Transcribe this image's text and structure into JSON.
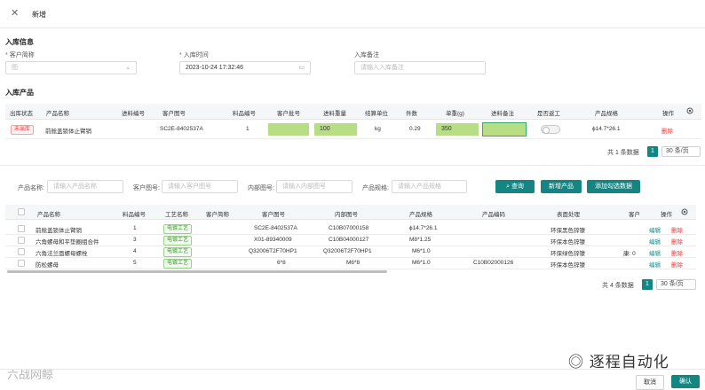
{
  "title": "新增",
  "section_info": "入库信息",
  "customer_label": "客户简称",
  "customer_value": "图 ",
  "intime_label": "入库时间",
  "intime_value": "2023-10-24 17:32:46",
  "remark_label": "入库备注",
  "remark_placeholder": "请输入入库备注",
  "section_products": "入库产品",
  "t1_headers": [
    "出库状态",
    "产品名称",
    "进料编号",
    "客户图号",
    "料品编号",
    "客户批号",
    "进料重量",
    "结算单位",
    "件数",
    "单重(g)",
    "进料备注",
    "是否返工",
    "产品规格",
    "操作"
  ],
  "t1_row": {
    "status": "未出库",
    "name": "前舱盖锁体止臂销",
    "code": "",
    "drawing": "SC2E-8402537A",
    "item_no": "1",
    "batch": "",
    "weight": "100",
    "unit": "kg",
    "count": "0.29",
    "unit_weight": "350",
    "note": "",
    "spec": "ϕ14.7*26.1",
    "op": "删除"
  },
  "pager1": {
    "total": "共 1 条数据",
    "page": "1",
    "size": "30 条/页"
  },
  "filter": {
    "name_label": "产品名称:",
    "name_ph": "请输入产品名称",
    "cust_label": "客户图号:",
    "cust_ph": "请输入客户图号",
    "inner_label": "内部图号:",
    "inner_ph": "请输入内部图号",
    "spec_label": "产品规格:",
    "spec_ph": "请输入产品规格"
  },
  "buttons": {
    "search": "查询",
    "new": "新增产品",
    "add_selected": "添加勾选数据",
    "cancel": "取消",
    "confirm": "确认"
  },
  "t2_headers": [
    "产品名称",
    "料品编号",
    "工艺名称",
    "客户简称",
    "客户图号",
    "内部图号",
    "产品规格",
    "产品编码",
    "表面处理",
    "客户",
    "操作"
  ],
  "t2_rows": [
    {
      "name": "前舱盖锁体止臂销",
      "no": "1",
      "proc": "电镀工艺",
      "cust": "",
      "cdraw": "SC2E-8402537A",
      "idraw": "C10B07000158",
      "spec": "ϕ14.7*26.1",
      "pcode": "",
      "surf": "环保黑色锌镍",
      "extra": ""
    },
    {
      "name": "六角螺母和平垫圈组合件",
      "no": "3",
      "proc": "电镀工艺",
      "cust": "",
      "cdraw": "X01-89340009",
      "idraw": "C10B04000127",
      "spec": "M8*1.25",
      "pcode": "",
      "surf": "环保本色锌镍",
      "extra": ""
    },
    {
      "name": "六角法兰面螺母螺栓",
      "no": "4",
      "proc": "电镀工艺",
      "cust": "",
      "cdraw": "Q32006T2F70HP1",
      "idraw": "Q32006T2F70HP1",
      "spec": "M6*1.0",
      "pcode": "",
      "surf": "环保绿色锌镍",
      "extra": "康: 0"
    },
    {
      "name": "防松螺母",
      "no": "5",
      "proc": "电镀工艺",
      "cust": "",
      "cdraw": "6*8",
      "idraw": "M6*8",
      "spec": "M6*1.0",
      "pcode": "C10B02000126",
      "surf": "环保本色锌镍",
      "extra": ""
    }
  ],
  "row_ops": {
    "edit": "编辑",
    "del": "删除"
  },
  "pager2": {
    "total": "共 4 条数据",
    "page": "1",
    "size": "30 条/页"
  },
  "watermark_left": "六战网鲸",
  "watermark_right": "逐程自动化"
}
